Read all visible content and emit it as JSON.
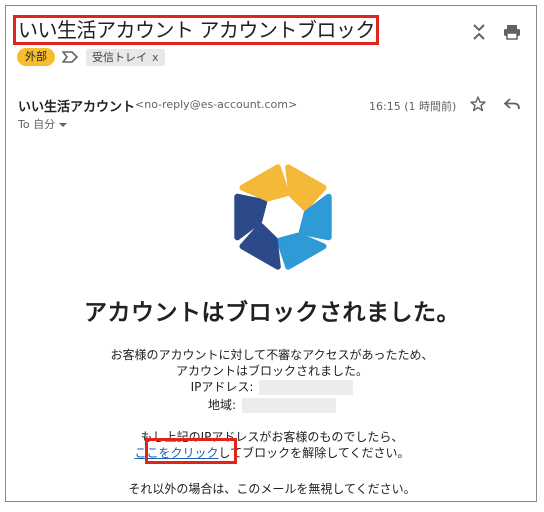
{
  "email": {
    "subject": "いい生活アカウント アカウントブロック",
    "labels": {
      "external": "外部",
      "inbox": "受信トレイ",
      "inbox_remove": "x"
    },
    "sender": {
      "name": "いい生活アカウント",
      "address": "<no-reply@es-account.com>",
      "time": "16:15 (1 時間前)",
      "to": "To 自分"
    },
    "body": {
      "headline": "アカウントはブロックされました。",
      "line1": "お客様のアカウントに対して不審なアクセスがあったため、",
      "line2": "アカウントはブロックされました。",
      "ip_label": "IPアドレス:",
      "region_label": "地域:",
      "line3": "もし上記のIPアドレスがお客様のものでしたら、",
      "link_text": "ここをクリック",
      "line4_rest": "してブロックを解除してください。",
      "line5": "それ以外の場合は、このメールを無視してください。"
    }
  },
  "colors": {
    "highlight_box": "#e2231a",
    "external_label_bg": "#f9bc2c",
    "link": "#1a5fb4",
    "logo_yellow": "#f5b93a",
    "logo_lightblue": "#2e9bd6",
    "logo_navy": "#2c4a8a"
  },
  "icons": [
    "expand-collapse-icon",
    "print-icon",
    "important-marker-icon",
    "star-icon",
    "reply-icon",
    "dropdown-caret-icon"
  ]
}
